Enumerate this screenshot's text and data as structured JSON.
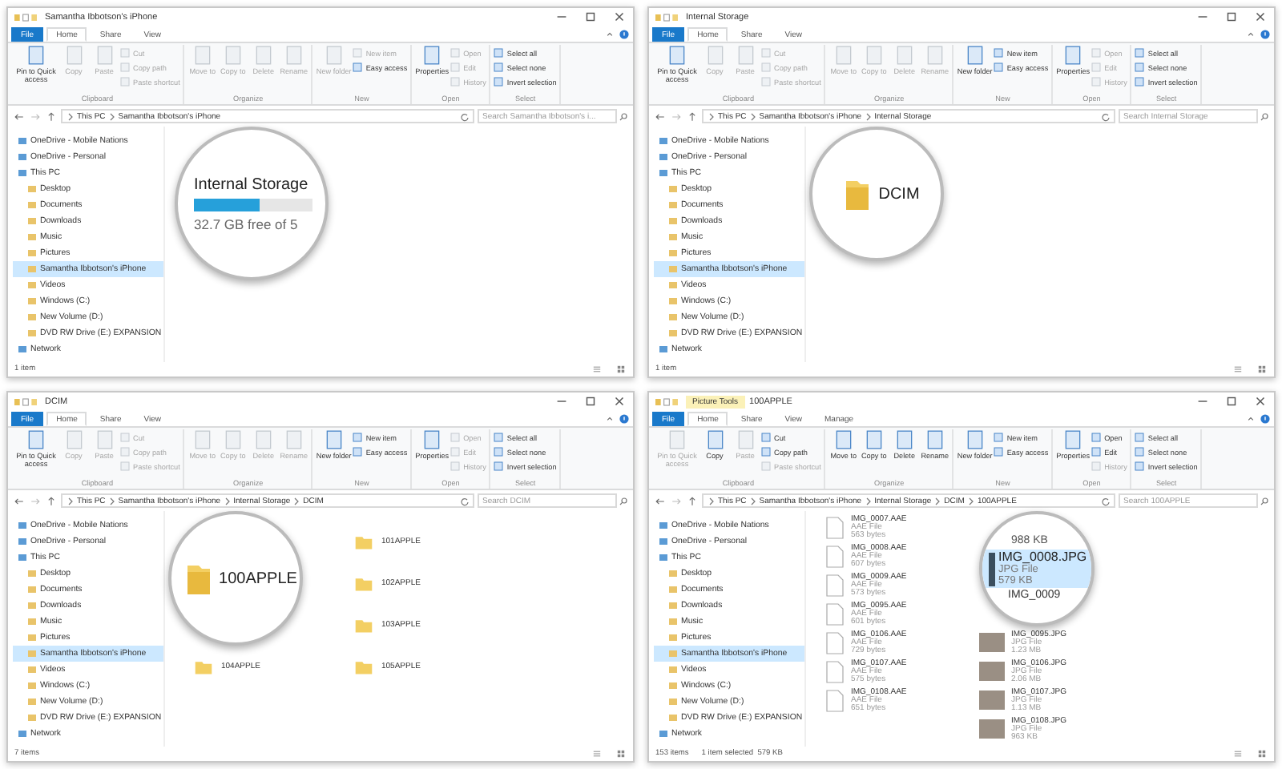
{
  "windows": [
    {
      "title": "Samantha Ibbotson's iPhone",
      "tabs": [
        {
          "label": "File",
          "kind": "file",
          "selected": false
        },
        {
          "label": "Home",
          "kind": "tab",
          "selected": true
        },
        {
          "label": "Share",
          "kind": "tab",
          "selected": false
        },
        {
          "label": "View",
          "kind": "tab",
          "selected": false
        }
      ],
      "ribbon": [
        {
          "label": "Clipboard",
          "buttons": [
            {
              "label": "Pin to Quick access",
              "kind": "large",
              "disabled": false
            },
            {
              "label": "Copy",
              "kind": "large",
              "disabled": true
            },
            {
              "label": "Paste",
              "kind": "large",
              "disabled": true
            },
            {
              "label": "Cut",
              "kind": "small",
              "disabled": true
            },
            {
              "label": "Copy path",
              "kind": "small",
              "disabled": true
            },
            {
              "label": "Paste shortcut",
              "kind": "small",
              "disabled": true
            }
          ]
        },
        {
          "label": "Organize",
          "buttons": [
            {
              "label": "Move to",
              "kind": "large",
              "disabled": true
            },
            {
              "label": "Copy to",
              "kind": "large",
              "disabled": true
            },
            {
              "label": "Delete",
              "kind": "large",
              "disabled": true
            },
            {
              "label": "Rename",
              "kind": "large",
              "disabled": true
            }
          ]
        },
        {
          "label": "New",
          "buttons": [
            {
              "label": "New folder",
              "kind": "large",
              "disabled": true
            },
            {
              "label": "New item",
              "kind": "small",
              "disabled": true
            },
            {
              "label": "Easy access",
              "kind": "small",
              "disabled": false
            }
          ]
        },
        {
          "label": "Open",
          "buttons": [
            {
              "label": "Properties",
              "kind": "large",
              "disabled": false
            },
            {
              "label": "Open",
              "kind": "small",
              "disabled": true
            },
            {
              "label": "Edit",
              "kind": "small",
              "disabled": true
            },
            {
              "label": "History",
              "kind": "small",
              "disabled": true
            }
          ]
        },
        {
          "label": "Select",
          "buttons": [
            {
              "label": "Select all",
              "kind": "small",
              "disabled": false
            },
            {
              "label": "Select none",
              "kind": "small",
              "disabled": false
            },
            {
              "label": "Invert selection",
              "kind": "small",
              "disabled": false
            }
          ]
        }
      ],
      "crumbs": [
        "This PC",
        "Samantha Ibbotson's iPhone"
      ],
      "search": {
        "placeholder": "Search Samantha Ibbotson's i..."
      },
      "nav": [
        {
          "label": "OneDrive - Mobile Nations",
          "selected": false
        },
        {
          "label": "OneDrive - Personal",
          "selected": false
        },
        {
          "label": "This PC",
          "selected": false,
          "children": [
            {
              "label": "Desktop",
              "selected": false
            },
            {
              "label": "Documents",
              "selected": false
            },
            {
              "label": "Downloads",
              "selected": false
            },
            {
              "label": "Music",
              "selected": false
            },
            {
              "label": "Pictures",
              "selected": false
            },
            {
              "label": "Samantha Ibbotson's iPhone",
              "selected": true
            },
            {
              "label": "Videos",
              "selected": false
            },
            {
              "label": "Windows (C:)",
              "selected": false
            },
            {
              "label": "New Volume (D:)",
              "selected": false
            },
            {
              "label": "DVD RW Drive (E:) EXPANSION",
              "selected": false
            }
          ]
        },
        {
          "label": "Network",
          "selected": false
        }
      ],
      "content": {
        "kind": "drive"
      },
      "magnifier": {
        "kind": "drive",
        "name": "Internal Storage",
        "level": 0.55,
        "free": "32.7 GB free of 5"
      },
      "status": [
        "1 item"
      ]
    },
    {
      "title": "Internal Storage",
      "tabs": [
        {
          "label": "File",
          "kind": "file",
          "selected": false
        },
        {
          "label": "Home",
          "kind": "tab",
          "selected": true
        },
        {
          "label": "Share",
          "kind": "tab",
          "selected": false
        },
        {
          "label": "View",
          "kind": "tab",
          "selected": false
        }
      ],
      "ribbon": [
        {
          "label": "Clipboard",
          "buttons": [
            {
              "label": "Pin to Quick access",
              "kind": "large",
              "disabled": false
            },
            {
              "label": "Copy",
              "kind": "large",
              "disabled": true
            },
            {
              "label": "Paste",
              "kind": "large",
              "disabled": true
            },
            {
              "label": "Cut",
              "kind": "small",
              "disabled": true
            },
            {
              "label": "Copy path",
              "kind": "small",
              "disabled": true
            },
            {
              "label": "Paste shortcut",
              "kind": "small",
              "disabled": true
            }
          ]
        },
        {
          "label": "Organize",
          "buttons": [
            {
              "label": "Move to",
              "kind": "large",
              "disabled": true
            },
            {
              "label": "Copy to",
              "kind": "large",
              "disabled": true
            },
            {
              "label": "Delete",
              "kind": "large",
              "disabled": true
            },
            {
              "label": "Rename",
              "kind": "large",
              "disabled": true
            }
          ]
        },
        {
          "label": "New",
          "buttons": [
            {
              "label": "New folder",
              "kind": "large",
              "disabled": false
            },
            {
              "label": "New item",
              "kind": "small",
              "disabled": false
            },
            {
              "label": "Easy access",
              "kind": "small",
              "disabled": false
            }
          ]
        },
        {
          "label": "Open",
          "buttons": [
            {
              "label": "Properties",
              "kind": "large",
              "disabled": false
            },
            {
              "label": "Open",
              "kind": "small",
              "disabled": true
            },
            {
              "label": "Edit",
              "kind": "small",
              "disabled": true
            },
            {
              "label": "History",
              "kind": "small",
              "disabled": true
            }
          ]
        },
        {
          "label": "Select",
          "buttons": [
            {
              "label": "Select all",
              "kind": "small",
              "disabled": false
            },
            {
              "label": "Select none",
              "kind": "small",
              "disabled": false
            },
            {
              "label": "Invert selection",
              "kind": "small",
              "disabled": false
            }
          ]
        }
      ],
      "crumbs": [
        "This PC",
        "Samantha Ibbotson's iPhone",
        "Internal Storage"
      ],
      "search": {
        "placeholder": "Search Internal Storage"
      },
      "nav": [
        {
          "label": "OneDrive - Mobile Nations",
          "selected": false
        },
        {
          "label": "OneDrive - Personal",
          "selected": false
        },
        {
          "label": "This PC",
          "selected": false,
          "children": [
            {
              "label": "Desktop",
              "selected": false
            },
            {
              "label": "Documents",
              "selected": false
            },
            {
              "label": "Downloads",
              "selected": false
            },
            {
              "label": "Music",
              "selected": false
            },
            {
              "label": "Pictures",
              "selected": false
            },
            {
              "label": "Samantha Ibbotson's iPhone",
              "selected": true
            },
            {
              "label": "Videos",
              "selected": false
            },
            {
              "label": "Windows (C:)",
              "selected": false
            },
            {
              "label": "New Volume (D:)",
              "selected": false
            },
            {
              "label": "DVD RW Drive (E:) EXPANSION",
              "selected": false
            }
          ]
        },
        {
          "label": "Network",
          "selected": false
        }
      ],
      "content": {
        "kind": "folders"
      },
      "magnifier": {
        "kind": "folder",
        "name": "DCIM"
      },
      "status": [
        "1 item"
      ]
    },
    {
      "title": "DCIM",
      "tabs": [
        {
          "label": "File",
          "kind": "file",
          "selected": false
        },
        {
          "label": "Home",
          "kind": "tab",
          "selected": true
        },
        {
          "label": "Share",
          "kind": "tab",
          "selected": false
        },
        {
          "label": "View",
          "kind": "tab",
          "selected": false
        }
      ],
      "ribbon": [
        {
          "label": "Clipboard",
          "buttons": [
            {
              "label": "Pin to Quick access",
              "kind": "large",
              "disabled": false
            },
            {
              "label": "Copy",
              "kind": "large",
              "disabled": true
            },
            {
              "label": "Paste",
              "kind": "large",
              "disabled": true
            },
            {
              "label": "Cut",
              "kind": "small",
              "disabled": true
            },
            {
              "label": "Copy path",
              "kind": "small",
              "disabled": true
            },
            {
              "label": "Paste shortcut",
              "kind": "small",
              "disabled": true
            }
          ]
        },
        {
          "label": "Organize",
          "buttons": [
            {
              "label": "Move to",
              "kind": "large",
              "disabled": true
            },
            {
              "label": "Copy to",
              "kind": "large",
              "disabled": true
            },
            {
              "label": "Delete",
              "kind": "large",
              "disabled": true
            },
            {
              "label": "Rename",
              "kind": "large",
              "disabled": true
            }
          ]
        },
        {
          "label": "New",
          "buttons": [
            {
              "label": "New folder",
              "kind": "large",
              "disabled": false
            },
            {
              "label": "New item",
              "kind": "small",
              "disabled": false
            },
            {
              "label": "Easy access",
              "kind": "small",
              "disabled": false
            }
          ]
        },
        {
          "label": "Open",
          "buttons": [
            {
              "label": "Properties",
              "kind": "large",
              "disabled": false
            },
            {
              "label": "Open",
              "kind": "small",
              "disabled": true
            },
            {
              "label": "Edit",
              "kind": "small",
              "disabled": true
            },
            {
              "label": "History",
              "kind": "small",
              "disabled": true
            }
          ]
        },
        {
          "label": "Select",
          "buttons": [
            {
              "label": "Select all",
              "kind": "small",
              "disabled": false
            },
            {
              "label": "Select none",
              "kind": "small",
              "disabled": false
            },
            {
              "label": "Invert selection",
              "kind": "small",
              "disabled": false
            }
          ]
        }
      ],
      "crumbs": [
        "This PC",
        "Samantha Ibbotson's iPhone",
        "Internal Storage",
        "DCIM"
      ],
      "search": {
        "placeholder": "Search DCIM"
      },
      "nav": [
        {
          "label": "OneDrive - Mobile Nations",
          "selected": false
        },
        {
          "label": "OneDrive - Personal",
          "selected": false
        },
        {
          "label": "This PC",
          "selected": false,
          "children": [
            {
              "label": "Desktop",
              "selected": false
            },
            {
              "label": "Documents",
              "selected": false
            },
            {
              "label": "Downloads",
              "selected": false
            },
            {
              "label": "Music",
              "selected": false
            },
            {
              "label": "Pictures",
              "selected": false
            },
            {
              "label": "Samantha Ibbotson's iPhone",
              "selected": true
            },
            {
              "label": "Videos",
              "selected": false
            },
            {
              "label": "Windows (C:)",
              "selected": false
            },
            {
              "label": "New Volume (D:)",
              "selected": false
            },
            {
              "label": "DVD RW Drive (E:) EXPANSION",
              "selected": false
            }
          ]
        },
        {
          "label": "Network",
          "selected": false
        }
      ],
      "content": {
        "kind": "folders",
        "items": [
          "101APPLE",
          "102APPLE",
          "103APPLE",
          "104APPLE",
          "105APPLE"
        ]
      },
      "magnifier": {
        "kind": "folder",
        "name": "100APPLE"
      },
      "status": [
        "7 items"
      ]
    },
    {
      "title": "100APPLE",
      "context_tab": "Picture Tools",
      "tabs": [
        {
          "label": "File",
          "kind": "file",
          "selected": false
        },
        {
          "label": "Home",
          "kind": "tab",
          "selected": true
        },
        {
          "label": "Share",
          "kind": "tab",
          "selected": false
        },
        {
          "label": "View",
          "kind": "tab",
          "selected": false
        },
        {
          "label": "Manage",
          "kind": "tab",
          "selected": false
        }
      ],
      "ribbon": [
        {
          "label": "Clipboard",
          "buttons": [
            {
              "label": "Pin to Quick access",
              "kind": "large",
              "disabled": true
            },
            {
              "label": "Copy",
              "kind": "large",
              "disabled": false
            },
            {
              "label": "Paste",
              "kind": "large",
              "disabled": true
            },
            {
              "label": "Cut",
              "kind": "small",
              "disabled": false
            },
            {
              "label": "Copy path",
              "kind": "small",
              "disabled": false
            },
            {
              "label": "Paste shortcut",
              "kind": "small",
              "disabled": true
            }
          ]
        },
        {
          "label": "Organize",
          "buttons": [
            {
              "label": "Move to",
              "kind": "large",
              "disabled": false
            },
            {
              "label": "Copy to",
              "kind": "large",
              "disabled": false
            },
            {
              "label": "Delete",
              "kind": "large",
              "disabled": false
            },
            {
              "label": "Rename",
              "kind": "large",
              "disabled": false
            }
          ]
        },
        {
          "label": "New",
          "buttons": [
            {
              "label": "New folder",
              "kind": "large",
              "disabled": false
            },
            {
              "label": "New item",
              "kind": "small",
              "disabled": false
            },
            {
              "label": "Easy access",
              "kind": "small",
              "disabled": false
            }
          ]
        },
        {
          "label": "Open",
          "buttons": [
            {
              "label": "Properties",
              "kind": "large",
              "disabled": false
            },
            {
              "label": "Open",
              "kind": "small",
              "disabled": false
            },
            {
              "label": "Edit",
              "kind": "small",
              "disabled": false
            },
            {
              "label": "History",
              "kind": "small",
              "disabled": true
            }
          ]
        },
        {
          "label": "Select",
          "buttons": [
            {
              "label": "Select all",
              "kind": "small",
              "disabled": false
            },
            {
              "label": "Select none",
              "kind": "small",
              "disabled": false
            },
            {
              "label": "Invert selection",
              "kind": "small",
              "disabled": false
            }
          ]
        }
      ],
      "crumbs": [
        "This PC",
        "Samantha Ibbotson's iPhone",
        "Internal Storage",
        "DCIM",
        "100APPLE"
      ],
      "search": {
        "placeholder": "Search 100APPLE"
      },
      "nav": [
        {
          "label": "OneDrive - Mobile Nations",
          "selected": false
        },
        {
          "label": "OneDrive - Personal",
          "selected": false
        },
        {
          "label": "This PC",
          "selected": false,
          "children": [
            {
              "label": "Desktop",
              "selected": false
            },
            {
              "label": "Documents",
              "selected": false
            },
            {
              "label": "Downloads",
              "selected": false
            },
            {
              "label": "Music",
              "selected": false
            },
            {
              "label": "Pictures",
              "selected": false
            },
            {
              "label": "Samantha Ibbotson's iPhone",
              "selected": true
            },
            {
              "label": "Videos",
              "selected": false
            },
            {
              "label": "Windows (C:)",
              "selected": false
            },
            {
              "label": "New Volume (D:)",
              "selected": false
            },
            {
              "label": "DVD RW Drive (E:) EXPANSION",
              "selected": false
            }
          ]
        },
        {
          "label": "Network",
          "selected": false
        }
      ],
      "content": {
        "kind": "files",
        "items": [
          {
            "name": "IMG_0007.AAE",
            "type": "AAE File",
            "size": "563 bytes",
            "kind": "doc"
          },
          {
            "name": "IMG_0008.AAE",
            "type": "AAE File",
            "size": "607 bytes",
            "kind": "doc"
          },
          {
            "name": "IMG_0009.AAE",
            "type": "AAE File",
            "size": "573 bytes",
            "kind": "doc"
          },
          {
            "name": "IMG_0095.AAE",
            "type": "AAE File",
            "size": "601 bytes",
            "kind": "doc"
          },
          {
            "name": "IMG_0106.AAE",
            "type": "AAE File",
            "size": "729 bytes",
            "kind": "doc"
          },
          {
            "name": "IMG_0095.JPG",
            "type": "JPG File",
            "size": "1.23 MB",
            "kind": "photo"
          },
          {
            "name": "IMG_0107.AAE",
            "type": "AAE File",
            "size": "575 bytes",
            "kind": "doc"
          },
          {
            "name": "IMG_0106.JPG",
            "type": "JPG File",
            "size": "2.06 MB",
            "kind": "photo"
          },
          {
            "name": "IMG_0108.AAE",
            "type": "AAE File",
            "size": "651 bytes",
            "kind": "doc"
          },
          {
            "name": "IMG_0107.JPG",
            "type": "JPG File",
            "size": "1.13 MB",
            "kind": "photo"
          },
          {
            "name": "IMG_0108.JPG",
            "type": "JPG File",
            "size": "963 KB",
            "kind": "photo"
          }
        ]
      },
      "magnifier": {
        "kind": "file",
        "above": "988 KB",
        "name": "IMG_0008.JPG",
        "type": "JPG File",
        "size": "579 KB",
        "selected": true,
        "below": "IMG_0009"
      },
      "status": [
        "153 items",
        "1 item selected  579 KB"
      ]
    }
  ]
}
